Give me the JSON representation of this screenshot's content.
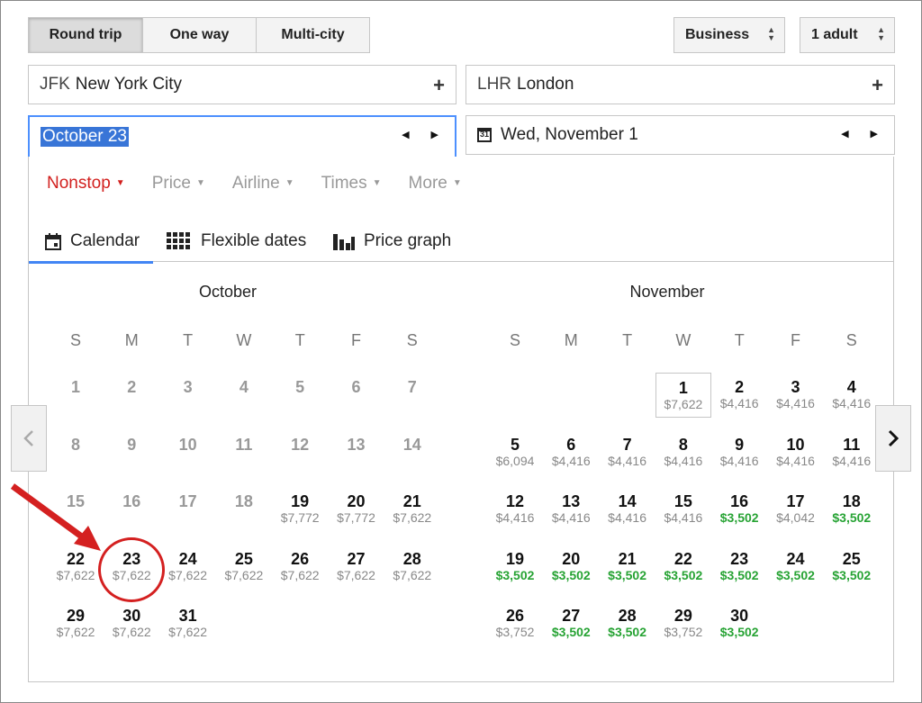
{
  "trip_types": [
    "Round trip",
    "One way",
    "Multi-city"
  ],
  "cabin": "Business",
  "passengers": "1 adult",
  "origin": {
    "code": "JFK",
    "city": "New York City"
  },
  "destination": {
    "code": "LHR",
    "city": "London"
  },
  "depart_date": "October 23",
  "return_date": "Wed, November 1",
  "return_icon_day": "31",
  "filters": [
    "Nonstop",
    "Price",
    "Airline",
    "Times",
    "More"
  ],
  "tabs": [
    "Calendar",
    "Flexible dates",
    "Price graph"
  ],
  "weekdays": [
    "S",
    "M",
    "T",
    "W",
    "T",
    "F",
    "S"
  ],
  "october": {
    "title": "October",
    "days": [
      {
        "d": "1"
      },
      {
        "d": "2"
      },
      {
        "d": "3"
      },
      {
        "d": "4"
      },
      {
        "d": "5"
      },
      {
        "d": "6"
      },
      {
        "d": "7"
      },
      {
        "d": "8"
      },
      {
        "d": "9"
      },
      {
        "d": "10"
      },
      {
        "d": "11"
      },
      {
        "d": "12"
      },
      {
        "d": "13"
      },
      {
        "d": "14"
      },
      {
        "d": "15"
      },
      {
        "d": "16"
      },
      {
        "d": "17"
      },
      {
        "d": "18"
      },
      {
        "d": "19",
        "p": "$7,772"
      },
      {
        "d": "20",
        "p": "$7,772"
      },
      {
        "d": "21",
        "p": "$7,622"
      },
      {
        "d": "22",
        "p": "$7,622"
      },
      {
        "d": "23",
        "p": "$7,622"
      },
      {
        "d": "24",
        "p": "$7,622"
      },
      {
        "d": "25",
        "p": "$7,622"
      },
      {
        "d": "26",
        "p": "$7,622"
      },
      {
        "d": "27",
        "p": "$7,622"
      },
      {
        "d": "28",
        "p": "$7,622"
      },
      {
        "d": "29",
        "p": "$7,622"
      },
      {
        "d": "30",
        "p": "$7,622"
      },
      {
        "d": "31",
        "p": "$7,622"
      }
    ]
  },
  "november": {
    "title": "November",
    "days": [
      {
        "d": "1",
        "p": "$7,622"
      },
      {
        "d": "2",
        "p": "$4,416"
      },
      {
        "d": "3",
        "p": "$4,416"
      },
      {
        "d": "4",
        "p": "$4,416"
      },
      {
        "d": "5",
        "p": "$6,094"
      },
      {
        "d": "6",
        "p": "$4,416"
      },
      {
        "d": "7",
        "p": "$4,416"
      },
      {
        "d": "8",
        "p": "$4,416"
      },
      {
        "d": "9",
        "p": "$4,416"
      },
      {
        "d": "10",
        "p": "$4,416"
      },
      {
        "d": "11",
        "p": "$4,416"
      },
      {
        "d": "12",
        "p": "$4,416"
      },
      {
        "d": "13",
        "p": "$4,416"
      },
      {
        "d": "14",
        "p": "$4,416"
      },
      {
        "d": "15",
        "p": "$4,416"
      },
      {
        "d": "16",
        "p": "$3,502",
        "g": true
      },
      {
        "d": "17",
        "p": "$4,042"
      },
      {
        "d": "18",
        "p": "$3,502",
        "g": true
      },
      {
        "d": "19",
        "p": "$3,502",
        "g": true
      },
      {
        "d": "20",
        "p": "$3,502",
        "g": true
      },
      {
        "d": "21",
        "p": "$3,502",
        "g": true
      },
      {
        "d": "22",
        "p": "$3,502",
        "g": true
      },
      {
        "d": "23",
        "p": "$3,502",
        "g": true
      },
      {
        "d": "24",
        "p": "$3,502",
        "g": true
      },
      {
        "d": "25",
        "p": "$3,502",
        "g": true
      },
      {
        "d": "26",
        "p": "$3,752"
      },
      {
        "d": "27",
        "p": "$3,502",
        "g": true
      },
      {
        "d": "28",
        "p": "$3,502",
        "g": true
      },
      {
        "d": "29",
        "p": "$3,752"
      },
      {
        "d": "30",
        "p": "$3,502",
        "g": true
      }
    ]
  },
  "colors": {
    "accent": "#4285f4",
    "red": "#d2201e",
    "green": "#27a334"
  }
}
